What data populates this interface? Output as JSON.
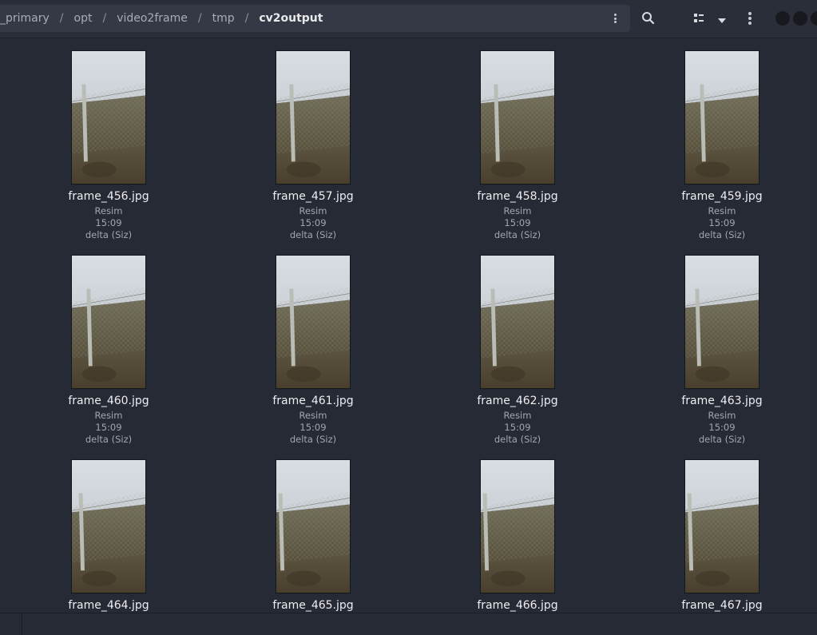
{
  "breadcrumbs": [
    "_primary",
    "opt",
    "video2frame",
    "tmp",
    "cv2output"
  ],
  "breadcrumb_separator": "/",
  "toolbar": {
    "path_menu_icon": "vertical-dots-icon",
    "search_icon": "search-icon",
    "view_icon": "list-view-icon",
    "view_dropdown_icon": "chevron-down-icon",
    "main_menu_icon": "vertical-dots-icon"
  },
  "files": [
    {
      "name": "frame_456.jpg",
      "type": "Resim",
      "time": "15:09",
      "owner": "delta (Siz)"
    },
    {
      "name": "frame_457.jpg",
      "type": "Resim",
      "time": "15:09",
      "owner": "delta (Siz)"
    },
    {
      "name": "frame_458.jpg",
      "type": "Resim",
      "time": "15:09",
      "owner": "delta (Siz)"
    },
    {
      "name": "frame_459.jpg",
      "type": "Resim",
      "time": "15:09",
      "owner": "delta (Siz)"
    },
    {
      "name": "frame_460.jpg",
      "type": "Resim",
      "time": "15:09",
      "owner": "delta (Siz)"
    },
    {
      "name": "frame_461.jpg",
      "type": "Resim",
      "time": "15:09",
      "owner": "delta (Siz)"
    },
    {
      "name": "frame_462.jpg",
      "type": "Resim",
      "time": "15:09",
      "owner": "delta (Siz)"
    },
    {
      "name": "frame_463.jpg",
      "type": "Resim",
      "time": "15:09",
      "owner": "delta (Siz)"
    },
    {
      "name": "frame_464.jpg"
    },
    {
      "name": "frame_465.jpg"
    },
    {
      "name": "frame_466.jpg"
    },
    {
      "name": "frame_467.jpg"
    }
  ],
  "colors": {
    "background": "#262a35",
    "header": "#2a2e39",
    "pathbar": "#343945",
    "text": "#eeeef0",
    "muted_text": "#a3a6ad"
  }
}
